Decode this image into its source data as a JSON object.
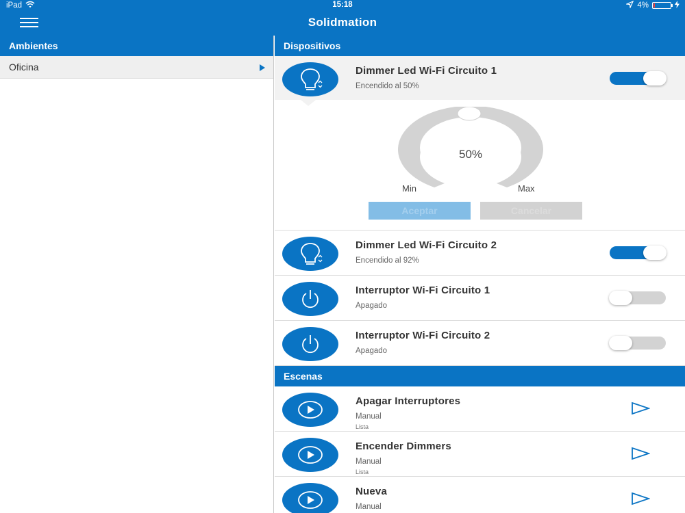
{
  "status_bar": {
    "device": "iPad",
    "time": "15:18",
    "battery": "4%"
  },
  "nav": {
    "title": "Solidmation"
  },
  "ambientes": {
    "header": "Ambientes",
    "items": [
      {
        "label": "Oficina"
      }
    ]
  },
  "dispositivos": {
    "header": "Dispositivos",
    "items": [
      {
        "title": "Dimmer Led Wi-Fi Circuito 1",
        "status": "Encendido al 50%",
        "on": true,
        "icon": "lightbulb-dimmer-icon"
      },
      {
        "title": "Dimmer Led Wi-Fi Circuito 2",
        "status": "Encendido al 92%",
        "on": true,
        "icon": "lightbulb-dimmer-icon"
      },
      {
        "title": "Interruptor Wi-Fi Circuito 1",
        "status": "Apagado",
        "on": false,
        "icon": "power-icon"
      },
      {
        "title": "Interruptor Wi-Fi Circuito 2",
        "status": "Apagado",
        "on": false,
        "icon": "power-icon"
      }
    ]
  },
  "dimmer_panel": {
    "value_label": "50%",
    "level": 0.5,
    "min_label": "Min",
    "max_label": "Max",
    "accept_label": "Aceptar",
    "cancel_label": "Cancelar"
  },
  "escenas": {
    "header": "Escenas",
    "items": [
      {
        "title": "Apagar Interruptores",
        "mode": "Manual",
        "state": "Lista"
      },
      {
        "title": "Encender Dimmers",
        "mode": "Manual",
        "state": "Lista"
      },
      {
        "title": "Nueva",
        "mode": "Manual",
        "state": ""
      }
    ]
  },
  "colors": {
    "accent": "#0a74c4",
    "row_selected": "#f2f2f2",
    "toggle_off": "#d3d3d3",
    "dial": "#d3d3d3"
  }
}
